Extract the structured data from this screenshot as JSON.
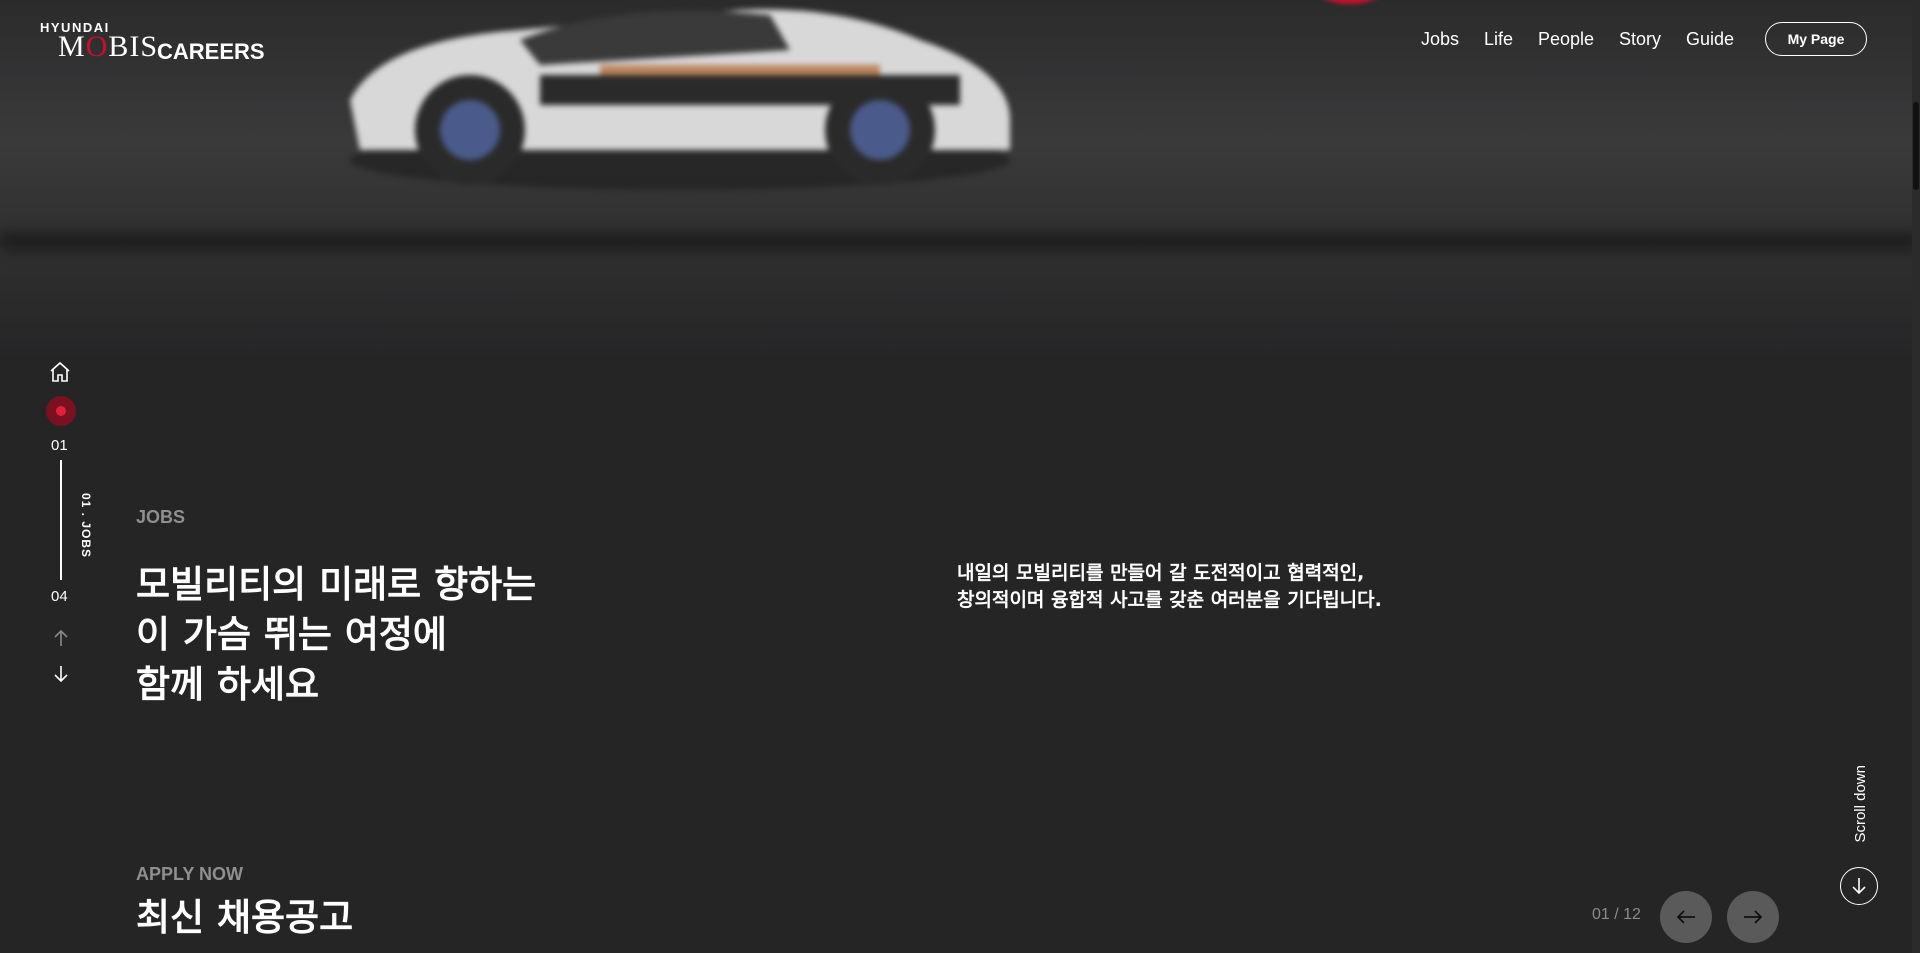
{
  "header": {
    "logo_top": "HYUNDAI",
    "logo_brand_first": "M",
    "logo_brand_o": "O",
    "logo_brand_rest": "BIS",
    "logo_careers": "CAREERS",
    "nav": [
      "Jobs",
      "Life",
      "People",
      "Story",
      "Guide"
    ],
    "my_page": "My Page"
  },
  "side_nav": {
    "current": "01",
    "total": "04",
    "section_label": "01 . JOBS"
  },
  "main": {
    "section_label": "JOBS",
    "headline_lines": [
      "모빌리티의 미래로 향하는",
      "이 가슴 뛰는 여정에",
      "함께 하세요"
    ],
    "description_lines": [
      "내일의 모빌리티를 만들어 갈 도전적이고 협력적인,",
      "창의적이며 융합적 사고를 갖춘 여러분을 기다립니다."
    ]
  },
  "apply": {
    "label": "APPLY NOW",
    "title": "최신 채용공고"
  },
  "pager": {
    "text": "01 / 12"
  },
  "scroll": {
    "text": "Scroll down"
  },
  "colors": {
    "background": "#252526",
    "accent": "#c8102e",
    "muted": "#8f8f8f",
    "pager_button": "#5a5a5a"
  }
}
